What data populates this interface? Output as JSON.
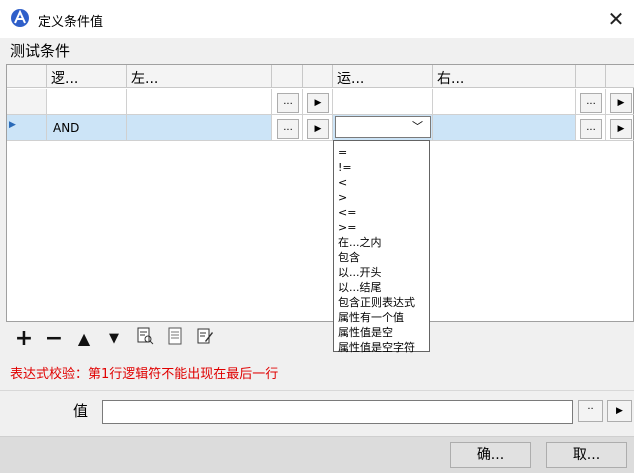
{
  "window": {
    "title": "定义条件值",
    "close_glyph": "✕"
  },
  "group_title": "测试条件",
  "grid": {
    "headers": [
      "逻...",
      "左...",
      "运...",
      "右..."
    ],
    "row2_logic": "AND",
    "ellipsis_glyph": "...",
    "play_glyph": "▶"
  },
  "operator_options": [
    "=",
    "!=",
    "<",
    ">",
    "<=",
    ">=",
    "在...之内",
    "包含",
    "以...开头",
    "以...结尾",
    "包含正则表达式",
    "属性有一个值",
    "属性值是空",
    "属性值是空字符"
  ],
  "toolbar": {
    "add": "+",
    "remove": "−",
    "up": "▲",
    "down": "▼"
  },
  "validation_message": "表达式校验：第1行逻辑符不能出现在最后一行",
  "value_label": "值",
  "value_input": "",
  "value_button_dots": "··",
  "buttons": {
    "ok": "确...",
    "cancel": "取..."
  }
}
